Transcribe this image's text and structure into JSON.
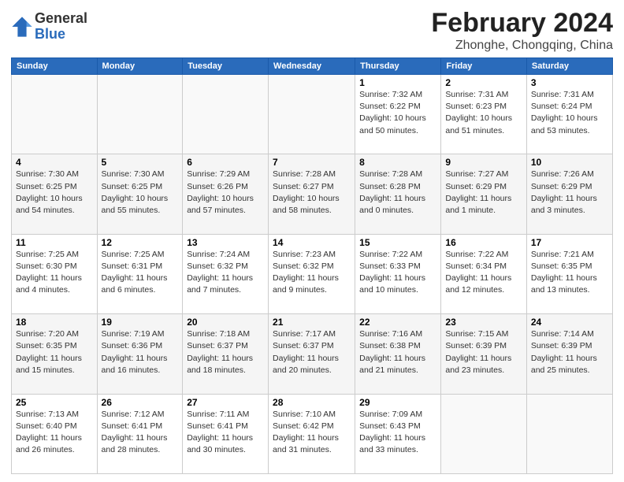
{
  "header": {
    "logo_general": "General",
    "logo_blue": "Blue",
    "title": "February 2024",
    "subtitle": "Zhonghe, Chongqing, China"
  },
  "calendar": {
    "weekdays": [
      "Sunday",
      "Monday",
      "Tuesday",
      "Wednesday",
      "Thursday",
      "Friday",
      "Saturday"
    ],
    "weeks": [
      [
        {
          "day": "",
          "info": ""
        },
        {
          "day": "",
          "info": ""
        },
        {
          "day": "",
          "info": ""
        },
        {
          "day": "",
          "info": ""
        },
        {
          "day": "1",
          "info": "Sunrise: 7:32 AM\nSunset: 6:22 PM\nDaylight: 10 hours and 50 minutes."
        },
        {
          "day": "2",
          "info": "Sunrise: 7:31 AM\nSunset: 6:23 PM\nDaylight: 10 hours and 51 minutes."
        },
        {
          "day": "3",
          "info": "Sunrise: 7:31 AM\nSunset: 6:24 PM\nDaylight: 10 hours and 53 minutes."
        }
      ],
      [
        {
          "day": "4",
          "info": "Sunrise: 7:30 AM\nSunset: 6:25 PM\nDaylight: 10 hours and 54 minutes."
        },
        {
          "day": "5",
          "info": "Sunrise: 7:30 AM\nSunset: 6:25 PM\nDaylight: 10 hours and 55 minutes."
        },
        {
          "day": "6",
          "info": "Sunrise: 7:29 AM\nSunset: 6:26 PM\nDaylight: 10 hours and 57 minutes."
        },
        {
          "day": "7",
          "info": "Sunrise: 7:28 AM\nSunset: 6:27 PM\nDaylight: 10 hours and 58 minutes."
        },
        {
          "day": "8",
          "info": "Sunrise: 7:28 AM\nSunset: 6:28 PM\nDaylight: 11 hours and 0 minutes."
        },
        {
          "day": "9",
          "info": "Sunrise: 7:27 AM\nSunset: 6:29 PM\nDaylight: 11 hours and 1 minute."
        },
        {
          "day": "10",
          "info": "Sunrise: 7:26 AM\nSunset: 6:29 PM\nDaylight: 11 hours and 3 minutes."
        }
      ],
      [
        {
          "day": "11",
          "info": "Sunrise: 7:25 AM\nSunset: 6:30 PM\nDaylight: 11 hours and 4 minutes."
        },
        {
          "day": "12",
          "info": "Sunrise: 7:25 AM\nSunset: 6:31 PM\nDaylight: 11 hours and 6 minutes."
        },
        {
          "day": "13",
          "info": "Sunrise: 7:24 AM\nSunset: 6:32 PM\nDaylight: 11 hours and 7 minutes."
        },
        {
          "day": "14",
          "info": "Sunrise: 7:23 AM\nSunset: 6:32 PM\nDaylight: 11 hours and 9 minutes."
        },
        {
          "day": "15",
          "info": "Sunrise: 7:22 AM\nSunset: 6:33 PM\nDaylight: 11 hours and 10 minutes."
        },
        {
          "day": "16",
          "info": "Sunrise: 7:22 AM\nSunset: 6:34 PM\nDaylight: 11 hours and 12 minutes."
        },
        {
          "day": "17",
          "info": "Sunrise: 7:21 AM\nSunset: 6:35 PM\nDaylight: 11 hours and 13 minutes."
        }
      ],
      [
        {
          "day": "18",
          "info": "Sunrise: 7:20 AM\nSunset: 6:35 PM\nDaylight: 11 hours and 15 minutes."
        },
        {
          "day": "19",
          "info": "Sunrise: 7:19 AM\nSunset: 6:36 PM\nDaylight: 11 hours and 16 minutes."
        },
        {
          "day": "20",
          "info": "Sunrise: 7:18 AM\nSunset: 6:37 PM\nDaylight: 11 hours and 18 minutes."
        },
        {
          "day": "21",
          "info": "Sunrise: 7:17 AM\nSunset: 6:37 PM\nDaylight: 11 hours and 20 minutes."
        },
        {
          "day": "22",
          "info": "Sunrise: 7:16 AM\nSunset: 6:38 PM\nDaylight: 11 hours and 21 minutes."
        },
        {
          "day": "23",
          "info": "Sunrise: 7:15 AM\nSunset: 6:39 PM\nDaylight: 11 hours and 23 minutes."
        },
        {
          "day": "24",
          "info": "Sunrise: 7:14 AM\nSunset: 6:39 PM\nDaylight: 11 hours and 25 minutes."
        }
      ],
      [
        {
          "day": "25",
          "info": "Sunrise: 7:13 AM\nSunset: 6:40 PM\nDaylight: 11 hours and 26 minutes."
        },
        {
          "day": "26",
          "info": "Sunrise: 7:12 AM\nSunset: 6:41 PM\nDaylight: 11 hours and 28 minutes."
        },
        {
          "day": "27",
          "info": "Sunrise: 7:11 AM\nSunset: 6:41 PM\nDaylight: 11 hours and 30 minutes."
        },
        {
          "day": "28",
          "info": "Sunrise: 7:10 AM\nSunset: 6:42 PM\nDaylight: 11 hours and 31 minutes."
        },
        {
          "day": "29",
          "info": "Sunrise: 7:09 AM\nSunset: 6:43 PM\nDaylight: 11 hours and 33 minutes."
        },
        {
          "day": "",
          "info": ""
        },
        {
          "day": "",
          "info": ""
        }
      ]
    ]
  }
}
